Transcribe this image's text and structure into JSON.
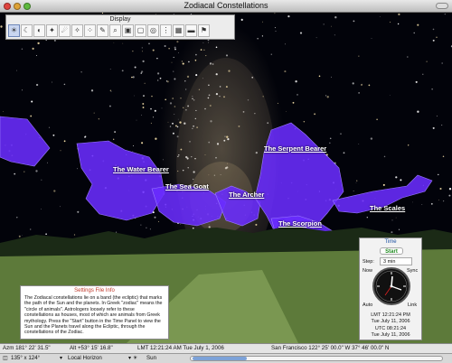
{
  "window": {
    "title": "Zodiacal Constellations"
  },
  "display_panel": {
    "title": "Display",
    "tools": [
      "sun-icon",
      "moon-icon",
      "planet-icon",
      "star-icon",
      "comet-icon",
      "constellation-icon",
      "cluster-icon",
      "pencil-icon",
      "magnifier-icon",
      "image-icon",
      "frame-icon",
      "swirl-icon",
      "dots-icon",
      "grid-icon",
      "horizon-icon",
      "flag-icon"
    ]
  },
  "constellations": {
    "water_bearer": "The Water Bearer",
    "sea_goat": "The Sea Goat",
    "archer": "The Archer",
    "serpent_bearer": "The Serpent Bearer",
    "scorpion": "The Scorpion",
    "scales": "The Scales"
  },
  "info_panel": {
    "heading": "Settings File Info",
    "text": "The Zodiacal constellations lie on a band (the ecliptic) that marks the path of the Sun and the planets. In Greek \"zodiac\" means the \"circle of animals\". Astrologers loosely refer to these constellations as houses, most of which are animals from Greek mythology. Press the \"Start\" button in the Time Panel to view the Sun and the Planets travel along the Ecliptic, through the constellations of the Zodiac."
  },
  "time_panel": {
    "title": "Time",
    "start": "Start",
    "step_label": "Step:",
    "step_value": "3 min",
    "now": "Now",
    "sync": "Sync",
    "auto": "Auto",
    "link": "Link",
    "lmt": "LMT 12:21:24 PM",
    "lmt_date": "Tue July 11, 2006",
    "utc": "UTC 08:21:24",
    "utc_date": "Tue July 11, 2006"
  },
  "status": {
    "azimuth": "Azm 181° 22' 31.5\"",
    "altitude": "Alt +53° 15' 16.8\"",
    "time": "LMT 12:21:24 AM  Tue   July 1, 2006",
    "location": "San Francisco  122° 25' 00.0\" W  37° 46' 00.0\" N"
  },
  "bottom": {
    "fov": "135° x 124°",
    "view": "Local Horizon",
    "sun": "Sun"
  },
  "colors": {
    "constellation_fill": "#6a2cff",
    "label": "#ffffff",
    "grass": "#5d7a3a"
  }
}
